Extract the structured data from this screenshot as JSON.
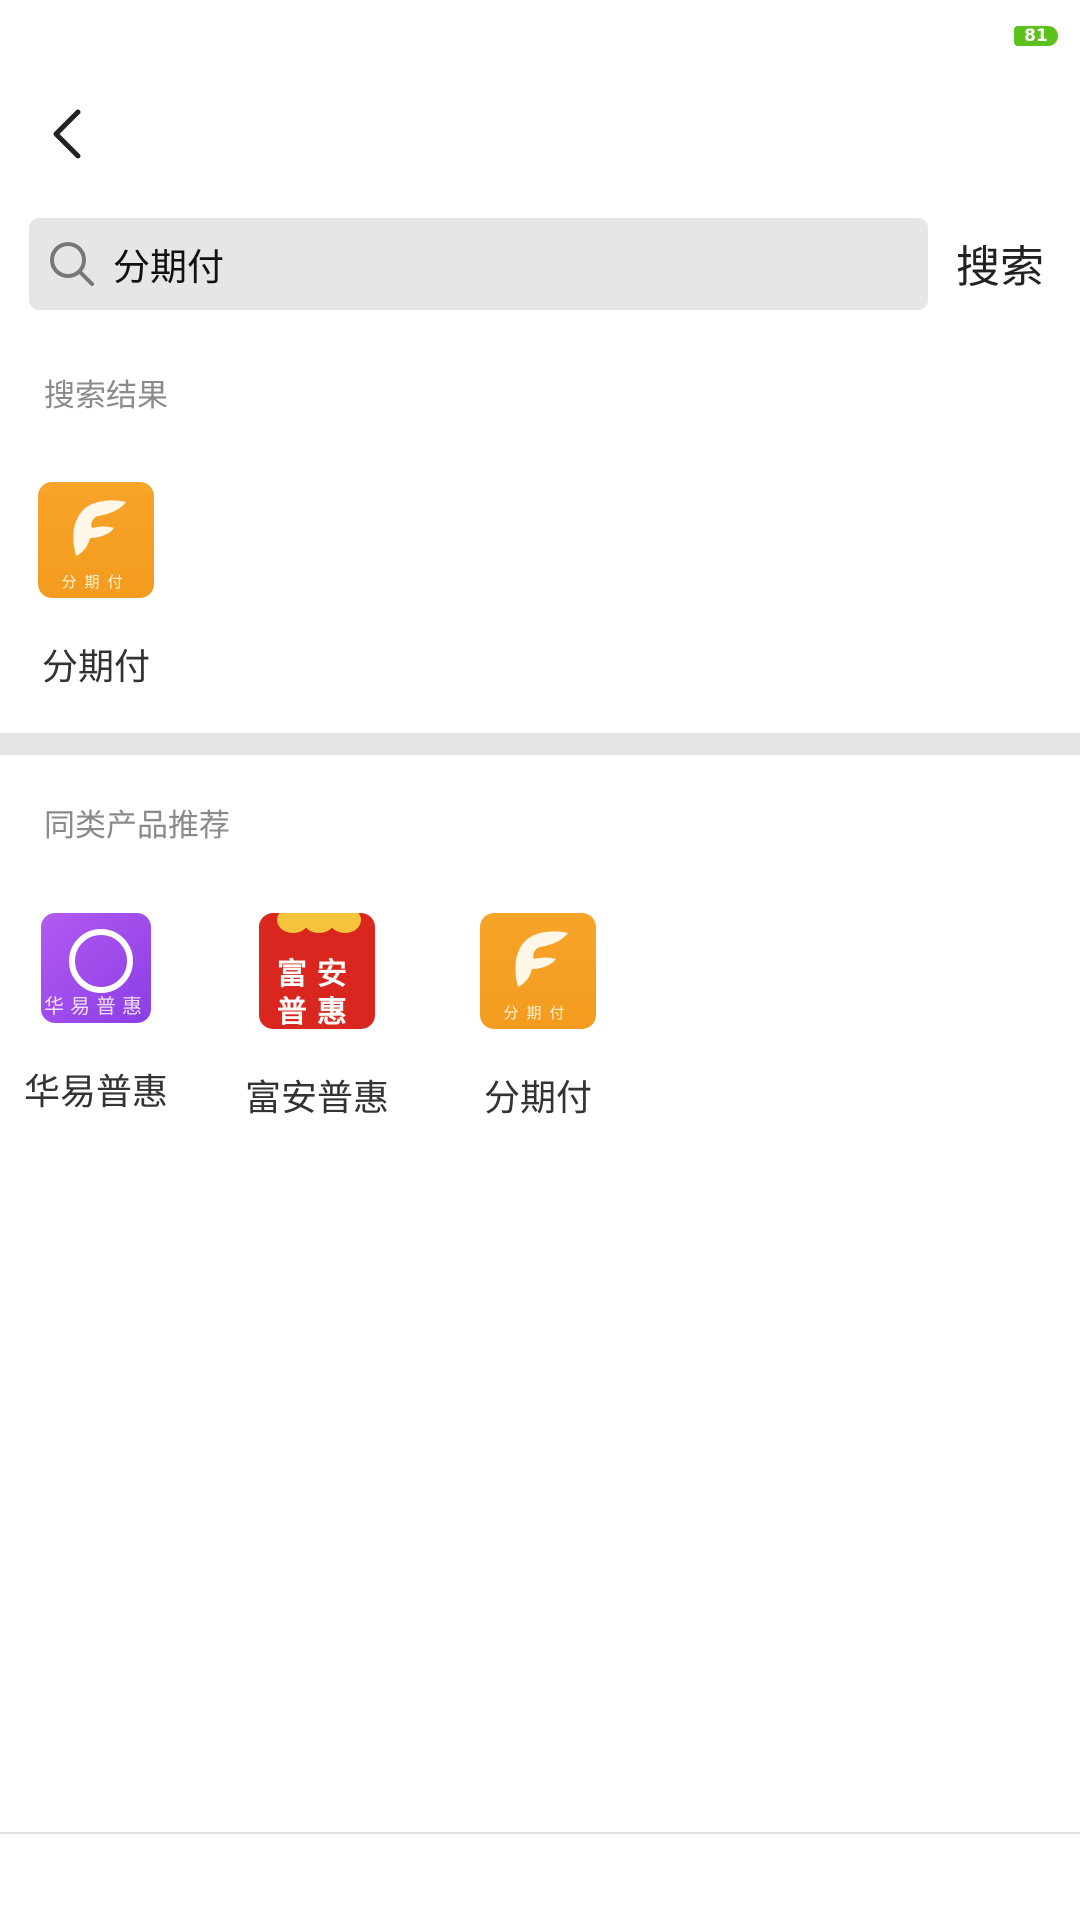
{
  "status_bar": {
    "battery": "81"
  },
  "search": {
    "value": "分期付",
    "button_label": "搜索"
  },
  "results": {
    "title": "搜索结果",
    "items": [
      {
        "label": "分期付",
        "icon": "fenqifu-logo",
        "icon_caption": "分期付",
        "color": "#f7a42a"
      }
    ]
  },
  "recommend": {
    "title": "同类产品推荐",
    "items": [
      {
        "label": "华易普惠",
        "icon": "huayi-logo",
        "icon_caption": "华易普惠",
        "color": "#9b4ae8"
      },
      {
        "label": "富安普惠",
        "icon": "fuan-logo",
        "icon_line1": "富安",
        "icon_line2": "普惠",
        "color": "#d9271f"
      },
      {
        "label": "分期付",
        "icon": "fenqifu-logo",
        "icon_caption": "分期付",
        "color": "#f7a42a"
      }
    ]
  }
}
